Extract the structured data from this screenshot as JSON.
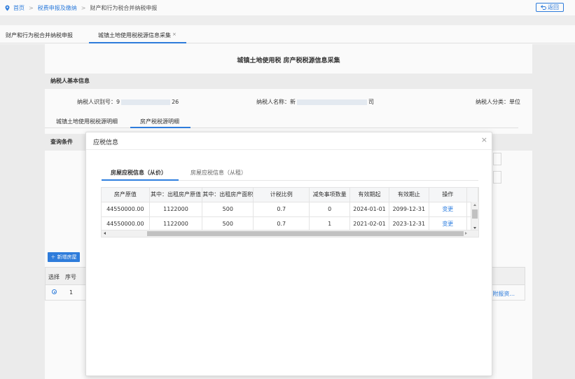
{
  "breadcrumb": {
    "home": "首页",
    "level1": "税费申报及缴纳",
    "level2": "财产和行为税合并纳税申报"
  },
  "back_button": "返回",
  "outer_tabs": [
    {
      "label": "财产和行为税合并纳税申报"
    },
    {
      "label": "城镇土地使用税税源信息采集",
      "close": "×"
    }
  ],
  "page": {
    "title": "城镇土地使用税 房产税税源信息采集",
    "section_basic": "纳税人基本信息",
    "taxpayer_id_label": "纳税人识别号：",
    "taxpayer_id_prefix": "9",
    "taxpayer_id_suffix": "26",
    "taxpayer_name_label": "纳税人名称：",
    "taxpayer_name_prefix": "新",
    "taxpayer_name_suffix": "司",
    "taxpayer_type_label": "纳税人分类：",
    "taxpayer_type_value": "单位",
    "inner_tabs": [
      {
        "label": "城镇土地使用税税源明细"
      },
      {
        "label": "房产税税源明细"
      }
    ],
    "query_head": "查询条件",
    "add_button": "新增房屋",
    "bg_table": {
      "headers": [
        "选择",
        "序号"
      ],
      "row": {
        "index": "1",
        "link": "附报资..."
      }
    }
  },
  "modal": {
    "title": "应税信息",
    "close": "×",
    "tabs": [
      {
        "label": "房屋应税信息（从价）",
        "active": true
      },
      {
        "label": "房屋应税信息（从租）",
        "active": false
      }
    ],
    "table": {
      "headers": [
        "房产原值",
        "其中：出租房产原值",
        "其中：出租房产面积",
        "计税比例",
        "减免事项数量",
        "有效期起",
        "有效期止",
        "操作"
      ],
      "rows": [
        [
          "44550000.00",
          "1122000",
          "500",
          "0.7",
          "0",
          "2024-01-01",
          "2099-12-31",
          "变更"
        ],
        [
          "44550000.00",
          "1122000",
          "500",
          "0.7",
          "1",
          "2021-02-01",
          "2023-12-31",
          "变更"
        ]
      ]
    }
  },
  "colors": {
    "accent": "#2f7fe0",
    "header_bg": "#f5f6f7",
    "section_bg": "#f0f0f0"
  }
}
